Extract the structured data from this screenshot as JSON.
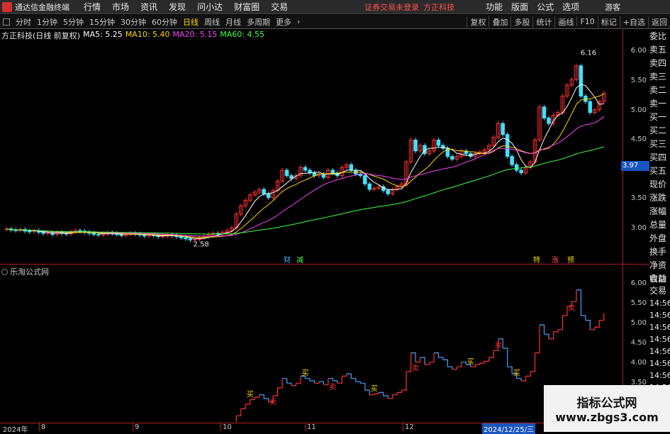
{
  "menubar": {
    "app_title": "通达信金融终端",
    "menus": [
      "行情",
      "市场",
      "资讯",
      "发现",
      "问小达",
      "财富圈",
      "交易"
    ],
    "notice": [
      "证券交易未登录",
      "方正科技"
    ],
    "right_menus": [
      "功能",
      "版面",
      "公式",
      "选项"
    ],
    "guest": "游客"
  },
  "toolbar": {
    "periods": [
      "分时",
      "1分钟",
      "5分钟",
      "15分钟",
      "30分钟",
      "60分钟",
      "日线",
      "周线",
      "月线",
      "多周期",
      "更多"
    ],
    "active_period": "日线",
    "right_buttons": [
      "复权",
      "叠加",
      "多股",
      "统计",
      "画线",
      "F10",
      "标记",
      "+自选",
      "返回"
    ]
  },
  "stock_info": {
    "title": "方正科技(日线 前复权)",
    "ma5": "MA5: 5.25",
    "ma10": "MA10: 5.40",
    "ma20": "MA20: 5.15",
    "ma60": "MA60: 4.55",
    "colors": {
      "ma5": "#ffffff",
      "ma10": "#ffd400",
      "ma20": "#ff40ff",
      "ma60": "#40ff40"
    }
  },
  "price_axis": [
    "6.00",
    "5.50",
    "5.00",
    "4.50",
    "4.00",
    "3.50",
    "3.00"
  ],
  "price_marker": "3.97",
  "high_label": "6.16",
  "low_label": "2.58",
  "chart_markers": [
    "财",
    "减",
    "特",
    "涨",
    "预"
  ],
  "side_tabs": [
    "委比",
    "卖五",
    "卖四",
    "卖三",
    "卖二",
    "卖一",
    "买一",
    "买二",
    "买三",
    "买四",
    "买五",
    "现价",
    "涨跌",
    "涨幅",
    "总量",
    "外盘",
    "换手",
    "净资",
    "收益"
  ],
  "sub_chart": {
    "title": "乐淘公式网",
    "axis": [
      "6.00",
      "5.50",
      "5.00",
      "4.50",
      "4.00",
      "3.50"
    ],
    "buy_label": "买",
    "sell_label": "卖"
  },
  "side_tabs2": {
    "auto": "自动",
    "trade": "交易",
    "times": [
      "14:56",
      "14:56",
      "14:56",
      "14:56",
      "14:56",
      "14:56",
      "14:56",
      "14:56"
    ]
  },
  "dates": [
    "2024年",
    "8",
    "9",
    "10",
    "11",
    "12"
  ],
  "current_date": "2024/12/25/三",
  "watermark": {
    "line1": "指标公式网",
    "line2": "www.zbgs3.com"
  },
  "chart_data": {
    "type": "candlestick",
    "xlabel": "",
    "ylabel": "",
    "ylim": [
      2.5,
      6.4
    ],
    "close": [
      2.98,
      2.96,
      2.95,
      2.97,
      2.94,
      2.93,
      2.95,
      2.92,
      2.9,
      2.91,
      2.88,
      2.92,
      2.9,
      2.89,
      2.93,
      2.95,
      2.94,
      2.92,
      2.9,
      2.88,
      2.87,
      2.89,
      2.91,
      2.9,
      2.88,
      2.86,
      2.88,
      2.9,
      2.89,
      2.87,
      2.85,
      2.87,
      2.86,
      2.84,
      2.85,
      2.87,
      2.86,
      2.84,
      2.82,
      2.8,
      2.78,
      2.79,
      2.82,
      2.85,
      2.88,
      2.9,
      2.89,
      2.92,
      2.95,
      3.0,
      3.25,
      3.4,
      3.5,
      3.6,
      3.65,
      3.7,
      3.62,
      3.55,
      3.68,
      3.85,
      4.05,
      3.95,
      3.9,
      3.95,
      4.1,
      4.05,
      4.0,
      3.95,
      3.98,
      3.92,
      4.05,
      4.0,
      3.95,
      4.1,
      4.15,
      4.05,
      3.98,
      3.95,
      3.8,
      3.7,
      3.72,
      3.75,
      3.68,
      3.62,
      3.7,
      3.75,
      3.8,
      4.2,
      4.6,
      4.4,
      4.5,
      4.35,
      4.4,
      4.6,
      4.5,
      4.45,
      4.3,
      4.25,
      4.3,
      4.4,
      4.35,
      4.3,
      4.35,
      4.38,
      4.42,
      4.5,
      4.65,
      4.9,
      4.7,
      4.3,
      4.15,
      4.05,
      4.0,
      4.1,
      4.2,
      4.6,
      5.2,
      5.0,
      4.9,
      5.05,
      5.1,
      5.4,
      5.6,
      5.7,
      5.95,
      5.4,
      5.3,
      5.1,
      5.15,
      5.3,
      5.45
    ],
    "ma_series": [
      {
        "name": "MA5",
        "color": "#ffffff"
      },
      {
        "name": "MA10",
        "color": "#ffd400"
      },
      {
        "name": "MA20",
        "color": "#ff40ff"
      },
      {
        "name": "MA60",
        "color": "#40ff40"
      }
    ],
    "up_color": "#ff3030",
    "down_color": "#40e0ff"
  }
}
